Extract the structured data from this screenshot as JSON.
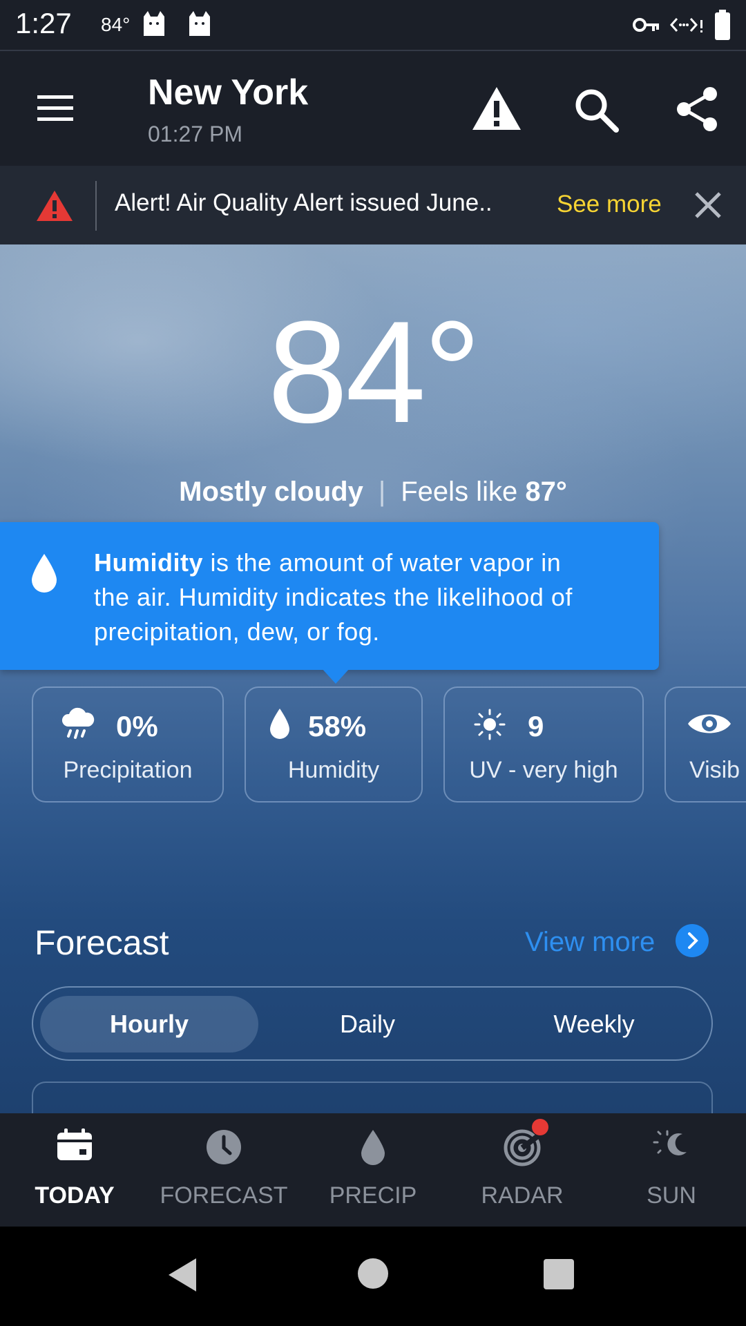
{
  "status_bar": {
    "time": "1:27",
    "temperature": "84°"
  },
  "app_bar": {
    "city": "New York",
    "local_time": "01:27 PM"
  },
  "alert_banner": {
    "text": "Alert! Air Quality Alert issued June..",
    "see_more": "See more"
  },
  "current": {
    "temperature": "84°",
    "condition": "Mostly cloudy",
    "feels_like_label": "Feels like",
    "feels_like_value": "87°"
  },
  "tooltip": {
    "term": "Humidity",
    "line1_rest": " is the amount of water vapor in",
    "line2": "the air. Humidity indicates the likelihood of",
    "line3": "precipitation, dew, or fog."
  },
  "metrics": [
    {
      "value": "0%",
      "label": "Precipitation",
      "icon": "rain-cloud-icon"
    },
    {
      "value": "58%",
      "label": "Humidity",
      "icon": "water-drop-icon"
    },
    {
      "value": "9",
      "label": "UV - very high",
      "icon": "sun-icon"
    },
    {
      "value": "",
      "label": "Visib",
      "icon": "eye-icon"
    }
  ],
  "forecast": {
    "title": "Forecast",
    "view_more": "View more",
    "tabs": [
      "Hourly",
      "Daily",
      "Weekly"
    ],
    "active_tab": "Hourly"
  },
  "bottom_nav": [
    {
      "label": "TODAY",
      "icon": "calendar-icon",
      "active": true
    },
    {
      "label": "FORECAST",
      "icon": "clock-icon",
      "active": false
    },
    {
      "label": "PRECIP",
      "icon": "drop-icon",
      "active": false
    },
    {
      "label": "RADAR",
      "icon": "radar-icon",
      "active": false
    },
    {
      "label": "SUN",
      "icon": "sun-moon-icon",
      "active": false
    }
  ],
  "colors": {
    "accent": "#1e88f2",
    "see_more": "#f7d433",
    "alert_red": "#e53935",
    "bar_bg": "#1b1f28"
  }
}
